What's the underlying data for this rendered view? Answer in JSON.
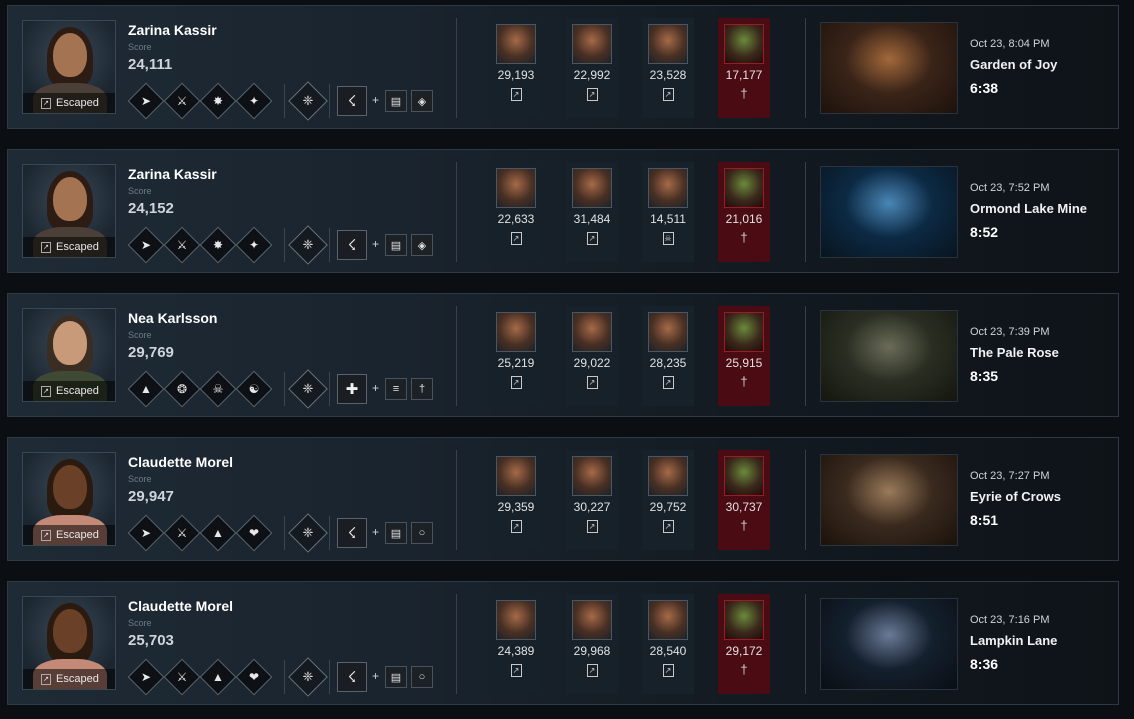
{
  "matches": [
    {
      "name": "Zarina Kassir",
      "score_label": "Score",
      "score": "24,111",
      "status": "Escaped",
      "portrait_colors": {
        "skin": "#a47452",
        "hair": "#2c1c14",
        "top": "#4a4038"
      },
      "perks": [
        "sprint-burst-icon",
        "dead-hard-icon",
        "adrenaline-icon",
        "borrowed-time-icon"
      ],
      "offering": "offering-icon",
      "item": "flashlight-icon",
      "addons": [
        "battery-addon-icon",
        "lens-addon-icon"
      ],
      "others": [
        {
          "score": "29,193",
          "status": "escaped-icon",
          "killer": false
        },
        {
          "score": "22,992",
          "status": "escaped-icon",
          "killer": false
        },
        {
          "score": "23,528",
          "status": "escaped-icon",
          "killer": false
        },
        {
          "score": "17,177",
          "status": "killer-icon",
          "killer": true
        }
      ],
      "map": {
        "date": "Oct 23, 8:04 PM",
        "name": "Garden of Joy",
        "duration": "6:38",
        "colors": [
          "#3a2418",
          "#a2683a",
          "#1c120c"
        ]
      }
    },
    {
      "name": "Zarina Kassir",
      "score_label": "Score",
      "score": "24,152",
      "status": "Escaped",
      "portrait_colors": {
        "skin": "#a47452",
        "hair": "#2c1c14",
        "top": "#4a4038"
      },
      "perks": [
        "sprint-burst-icon",
        "dead-hard-icon",
        "adrenaline-icon",
        "borrowed-time-icon"
      ],
      "offering": "offering-icon",
      "item": "flashlight-icon",
      "addons": [
        "battery-addon-icon",
        "lens-addon-icon"
      ],
      "others": [
        {
          "score": "22,633",
          "status": "escaped-icon",
          "killer": false
        },
        {
          "score": "31,484",
          "status": "escaped-icon",
          "killer": false
        },
        {
          "score": "14,511",
          "status": "sacrificed-icon",
          "killer": false
        },
        {
          "score": "21,016",
          "status": "killer-icon",
          "killer": true
        }
      ],
      "map": {
        "date": "Oct 23, 7:52 PM",
        "name": "Ormond Lake Mine",
        "duration": "8:52",
        "colors": [
          "#0c2a44",
          "#4a86b6",
          "#08141e"
        ]
      }
    },
    {
      "name": "Nea Karlsson",
      "score_label": "Score",
      "score": "29,769",
      "status": "Escaped",
      "portrait_colors": {
        "skin": "#c89a7a",
        "hair": "#3a2e24",
        "top": "#3e4a34"
      },
      "perks": [
        "balanced-landing-icon",
        "urban-evasion-icon",
        "smash-hit-icon",
        "resilience-icon"
      ],
      "offering": "offering-icon",
      "item": "medkit-icon",
      "addons": [
        "bandage-addon-icon",
        "syringe-addon-icon"
      ],
      "others": [
        {
          "score": "25,219",
          "status": "escaped-icon",
          "killer": false
        },
        {
          "score": "29,022",
          "status": "escaped-icon",
          "killer": false
        },
        {
          "score": "28,235",
          "status": "escaped-icon",
          "killer": false
        },
        {
          "score": "25,915",
          "status": "killer-icon",
          "killer": true
        }
      ],
      "map": {
        "date": "Oct 23, 7:39 PM",
        "name": "The Pale Rose",
        "duration": "8:35",
        "colors": [
          "#2a2e22",
          "#6a6c58",
          "#14160f"
        ]
      }
    },
    {
      "name": "Claudette Morel",
      "score_label": "Score",
      "score": "29,947",
      "status": "Escaped",
      "portrait_colors": {
        "skin": "#6a4028",
        "hair": "#2a1a10",
        "top": "#c48a78"
      },
      "perks": [
        "sprint-burst-icon",
        "dead-hard-icon",
        "balanced-landing-icon",
        "we-will-make-it-icon"
      ],
      "offering": "offering-icon",
      "item": "flashlight-icon",
      "addons": [
        "battery-addon-icon",
        "ring-addon-icon"
      ],
      "others": [
        {
          "score": "29,359",
          "status": "escaped-icon",
          "killer": false
        },
        {
          "score": "30,227",
          "status": "escaped-icon",
          "killer": false
        },
        {
          "score": "29,752",
          "status": "escaped-icon",
          "killer": false
        },
        {
          "score": "30,737",
          "status": "killer-icon",
          "killer": true
        }
      ],
      "map": {
        "date": "Oct 23, 7:27 PM",
        "name": "Eyrie of Crows",
        "duration": "8:51",
        "colors": [
          "#3a2a1e",
          "#9a7a5a",
          "#1a120c"
        ]
      }
    },
    {
      "name": "Claudette Morel",
      "score_label": "Score",
      "score": "25,703",
      "status": "Escaped",
      "portrait_colors": {
        "skin": "#6a4028",
        "hair": "#2a1a10",
        "top": "#c48a78"
      },
      "perks": [
        "sprint-burst-icon",
        "dead-hard-icon",
        "balanced-landing-icon",
        "we-will-make-it-icon"
      ],
      "offering": "offering-icon",
      "item": "flashlight-icon",
      "addons": [
        "battery-addon-icon",
        "ring-addon-icon"
      ],
      "others": [
        {
          "score": "24,389",
          "status": "escaped-icon",
          "killer": false
        },
        {
          "score": "29,968",
          "status": "escaped-icon",
          "killer": false
        },
        {
          "score": "28,540",
          "status": "escaped-icon",
          "killer": false
        },
        {
          "score": "29,172",
          "status": "killer-icon",
          "killer": true
        }
      ],
      "map": {
        "date": "Oct 23, 7:16 PM",
        "name": "Lampkin Lane",
        "duration": "8:36",
        "colors": [
          "#14202e",
          "#6a7a96",
          "#0a0e14"
        ]
      }
    }
  ]
}
